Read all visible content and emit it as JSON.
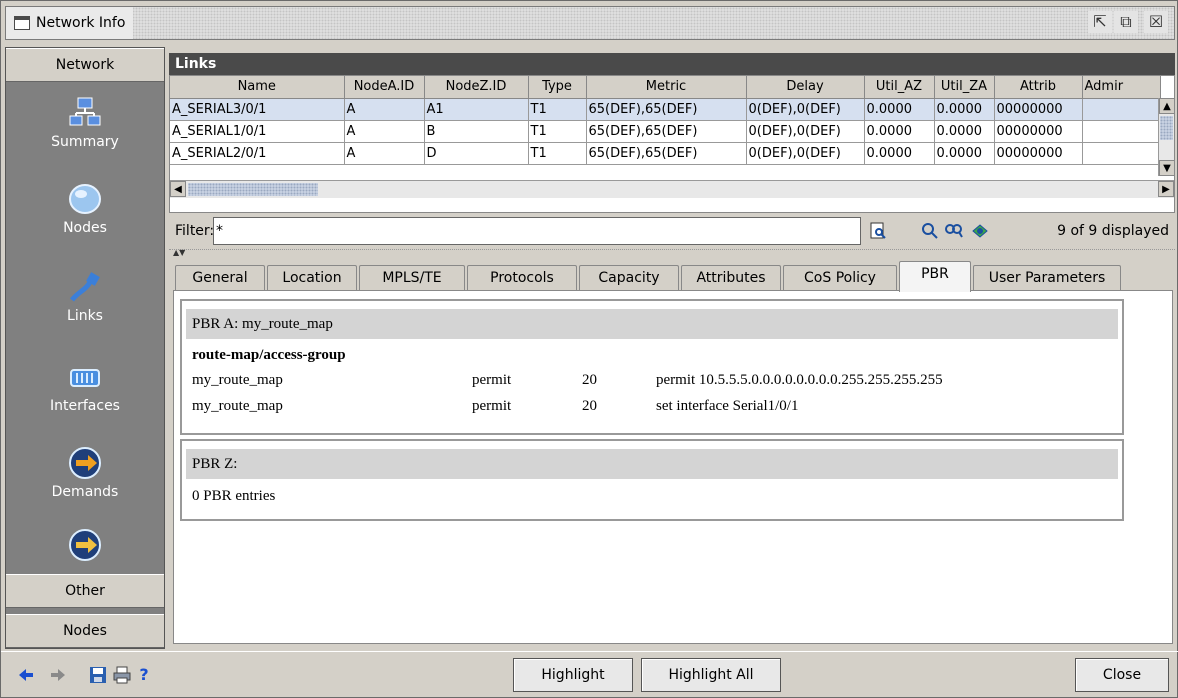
{
  "window": {
    "title": "Network Info"
  },
  "sidebar": {
    "top_header": "Network",
    "items": [
      {
        "label": "Summary",
        "icon": "summary-icon"
      },
      {
        "label": "Nodes",
        "icon": "nodes-icon"
      },
      {
        "label": "Links",
        "icon": "links-icon"
      },
      {
        "label": "Interfaces",
        "icon": "interfaces-icon"
      },
      {
        "label": "Demands",
        "icon": "demands-icon"
      }
    ],
    "bottom_headers": [
      "Other",
      "Nodes"
    ]
  },
  "links": {
    "title": "Links",
    "columns": [
      "Name",
      "NodeA.ID",
      "NodeZ.ID",
      "Type",
      "Metric",
      "Delay",
      "Util_AZ",
      "Util_ZA",
      "Attrib",
      "Admir"
    ],
    "rows": [
      [
        "A_SERIAL3/0/1",
        "A",
        "A1",
        "T1",
        "65(DEF),65(DEF)",
        "0(DEF),0(DEF)",
        "0.0000",
        "0.0000",
        "00000000",
        ""
      ],
      [
        "A_SERIAL1/0/1",
        "A",
        "B",
        "T1",
        "65(DEF),65(DEF)",
        "0(DEF),0(DEF)",
        "0.0000",
        "0.0000",
        "00000000",
        ""
      ],
      [
        "A_SERIAL2/0/1",
        "A",
        "D",
        "T1",
        "65(DEF),65(DEF)",
        "0(DEF),0(DEF)",
        "0.0000",
        "0.0000",
        "00000000",
        ""
      ]
    ]
  },
  "filter": {
    "label": "Filter:",
    "value": "*",
    "display_count": "9 of 9 displayed"
  },
  "tabs": [
    "General",
    "Location",
    "MPLS/TE",
    "Protocols",
    "Capacity",
    "Attributes",
    "CoS Policy",
    "PBR",
    "User Parameters"
  ],
  "active_tab": "PBR",
  "pbr": {
    "a_header": "PBR A: my_route_map",
    "a_subheader": "route-map/access-group",
    "a_rows": [
      [
        "my_route_map",
        "permit",
        "20",
        "permit 10.5.5.5.0.0.0.0.0.0.0.0.255.255.255.255"
      ],
      [
        "my_route_map",
        "permit",
        "20",
        "set interface Serial1/0/1"
      ]
    ],
    "z_header": "PBR Z:",
    "z_entries": "0 PBR entries"
  },
  "bottom": {
    "highlight": "Highlight",
    "highlight_all": "Highlight All",
    "close": "Close",
    "help": "?"
  }
}
